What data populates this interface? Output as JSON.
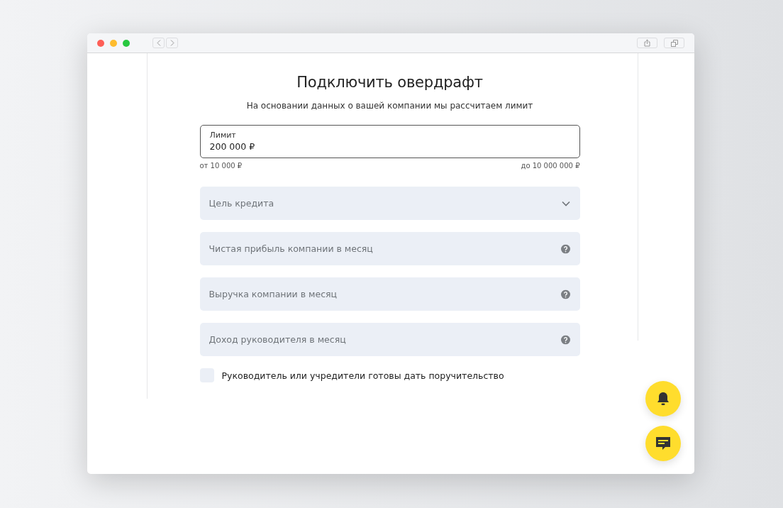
{
  "title": "Подключить овердрафт",
  "subtitle": "На основании данных о вашей компании мы рассчитаем лимит",
  "limit_field": {
    "label": "Лимит",
    "value": "200 000 ₽"
  },
  "range": {
    "min": "от 10 000 ₽",
    "max": "до 10 000 000 ₽"
  },
  "fields": [
    {
      "kind": "select",
      "placeholder": "Цель кредита"
    },
    {
      "kind": "help",
      "placeholder": "Чистая прибыль компании в месяц"
    },
    {
      "kind": "help",
      "placeholder": "Выручка компании в месяц"
    },
    {
      "kind": "help",
      "placeholder": "Доход руководителя в месяц"
    }
  ],
  "guarantee": {
    "label": "Руководитель или учредители готовы дать поручительство",
    "checked": false
  }
}
